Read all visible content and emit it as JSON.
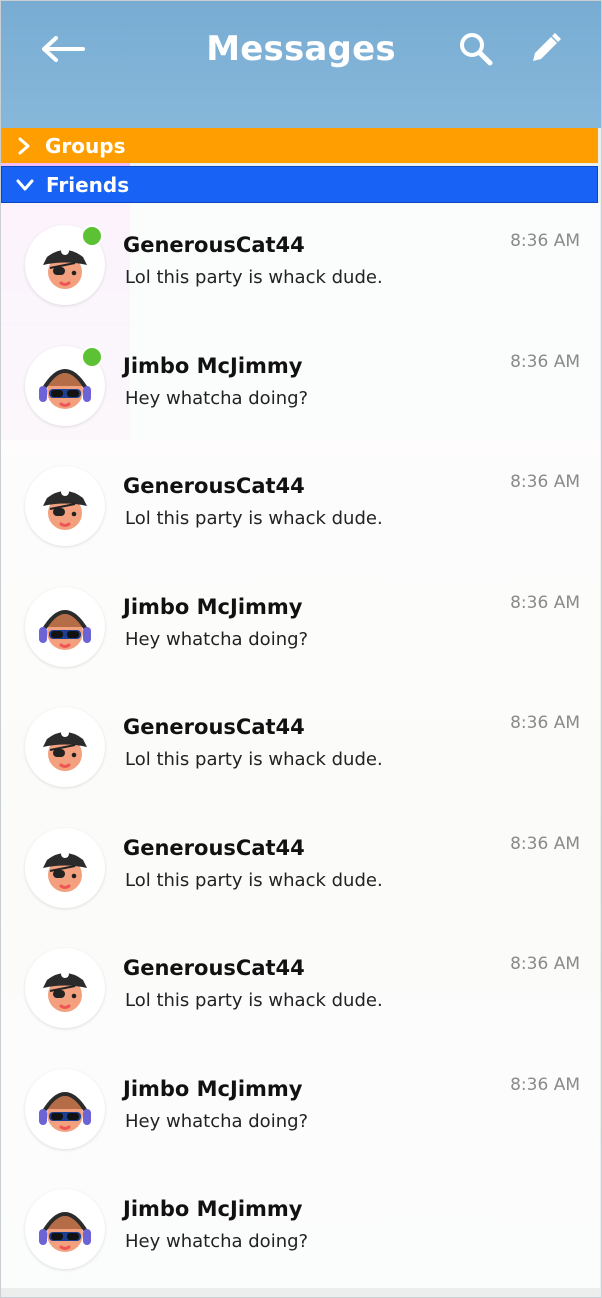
{
  "header": {
    "title": "Messages",
    "back_icon": "back-arrow-icon",
    "search_icon": "search-icon",
    "edit_icon": "pencil-icon"
  },
  "sections": {
    "groups_label": "Groups",
    "friends_label": "Friends"
  },
  "conversations": [
    {
      "name": "GenerousCat44",
      "message": "Lol this party is whack dude.",
      "time": "8:36 AM",
      "online": true,
      "avatar": "pirate-avatar"
    },
    {
      "name": "Jimbo McJimmy",
      "message": "Hey whatcha doing?",
      "time": "8:36 AM",
      "online": true,
      "avatar": "headphones-avatar"
    },
    {
      "name": "GenerousCat44",
      "message": "Lol this party is whack dude.",
      "time": "8:36 AM",
      "online": false,
      "avatar": "pirate-avatar"
    },
    {
      "name": "Jimbo McJimmy",
      "message": "Hey whatcha doing?",
      "time": "8:36 AM",
      "online": false,
      "avatar": "headphones-avatar"
    },
    {
      "name": "GenerousCat44",
      "message": "Lol this party is whack dude.",
      "time": "8:36 AM",
      "online": false,
      "avatar": "pirate-avatar"
    },
    {
      "name": "GenerousCat44",
      "message": "Lol this party is whack dude.",
      "time": "8:36 AM",
      "online": false,
      "avatar": "pirate-avatar"
    },
    {
      "name": "GenerousCat44",
      "message": "Lol this party is whack dude.",
      "time": "8:36 AM",
      "online": false,
      "avatar": "pirate-avatar"
    },
    {
      "name": "Jimbo McJimmy",
      "message": "Hey whatcha doing?",
      "time": "8:36 AM",
      "online": false,
      "avatar": "headphones-avatar"
    },
    {
      "name": "Jimbo McJimmy",
      "message": "Hey whatcha doing?",
      "time": "",
      "online": false,
      "avatar": "headphones-avatar"
    }
  ],
  "colors": {
    "header_bg": "#79acd3",
    "groups_bar": "#ff9e00",
    "friends_bar": "#1862f6",
    "online": "#5cc233"
  }
}
